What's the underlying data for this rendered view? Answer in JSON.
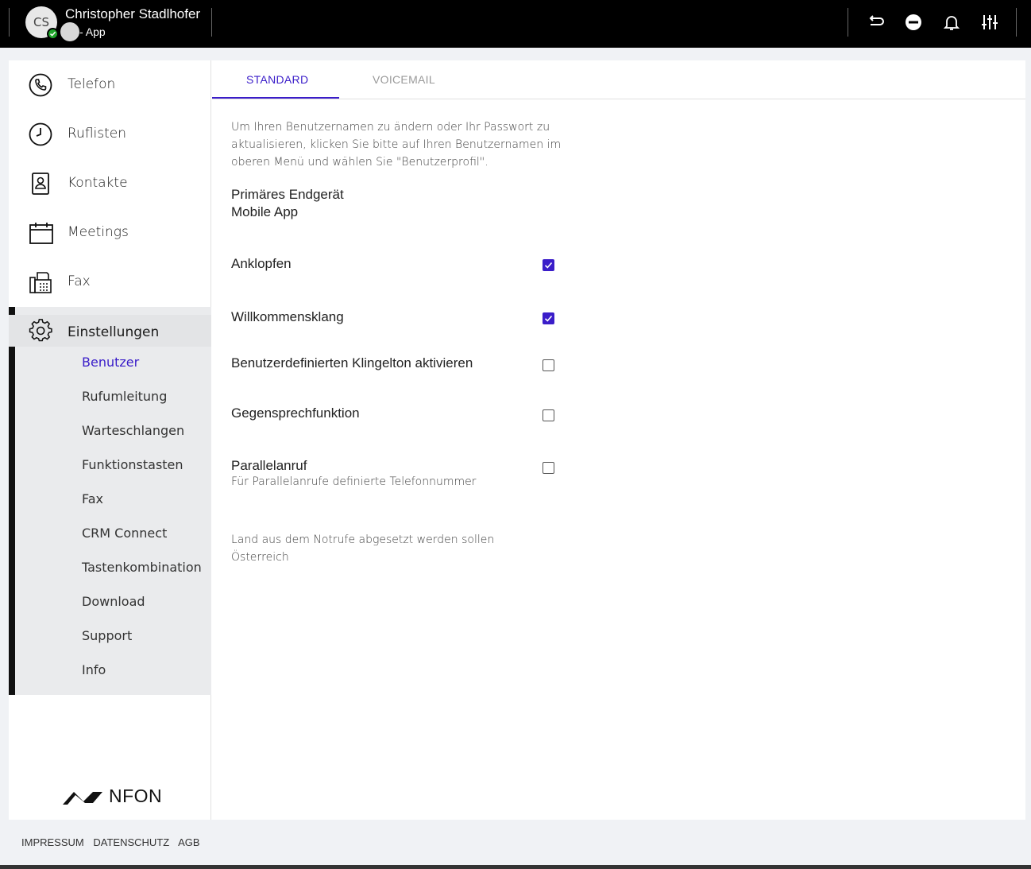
{
  "header": {
    "avatar_initials": "CS",
    "user_name": "Christopher Stadlhofer",
    "device_label": "- App",
    "status_color": "#1fa32a",
    "icons": [
      "callback-icon",
      "do-not-disturb-icon",
      "bell-icon",
      "sliders-icon"
    ]
  },
  "sidebar": {
    "items": [
      {
        "label": "Telefon",
        "icon": "phone-icon"
      },
      {
        "label": "Ruflisten",
        "icon": "clock-icon"
      },
      {
        "label": "Kontakte",
        "icon": "contact-card-icon"
      },
      {
        "label": "Meetings",
        "icon": "calendar-icon"
      },
      {
        "label": "Fax",
        "icon": "fax-icon"
      }
    ],
    "settings": {
      "label": "Einstellungen",
      "icon": "gear-icon",
      "subitems": [
        "Benutzer",
        "Rufumleitung",
        "Warteschlangen",
        "Funktionstasten",
        "Fax",
        "CRM Connect",
        "Tastenkombination",
        "Download",
        "Support",
        "Info"
      ],
      "active": "Benutzer"
    },
    "logo_text": "NFON"
  },
  "tabs": {
    "standard": "STANDARD",
    "voicemail": "VOICEMAIL",
    "active": "STANDARD"
  },
  "content": {
    "info_text": "Um Ihren Benutzernamen zu ändern oder Ihr Passwort zu aktualisieren, klicken Sie bitte auf Ihren Benutzernamen im oberen Menü und wählen Sie \"Benutzerprofil\".",
    "primary_device_label": "Primäres Endgerät",
    "primary_device_value": "Mobile App",
    "options": [
      {
        "label": "Anklopfen",
        "checked": true
      },
      {
        "label": "Willkommensklang",
        "checked": true
      },
      {
        "label": "Benutzerdefinierten Klingelton aktivieren",
        "checked": false
      },
      {
        "label": "Gegensprechfunktion",
        "checked": false
      },
      {
        "label": "Parallelanruf",
        "sublabel": "Für Parallelanrufe definierte Telefonnummer",
        "checked": false
      }
    ],
    "emergency_label": "Land aus dem Notrufe abgesetzt werden sollen",
    "emergency_value": "Österreich"
  },
  "footer": {
    "links": [
      "IMPRESSUM",
      "DATENSCHUTZ",
      "AGB"
    ]
  },
  "colors": {
    "accent": "#3a1dc9",
    "header_bg": "#000000",
    "sidebar_active_bg": "#eaebed"
  }
}
